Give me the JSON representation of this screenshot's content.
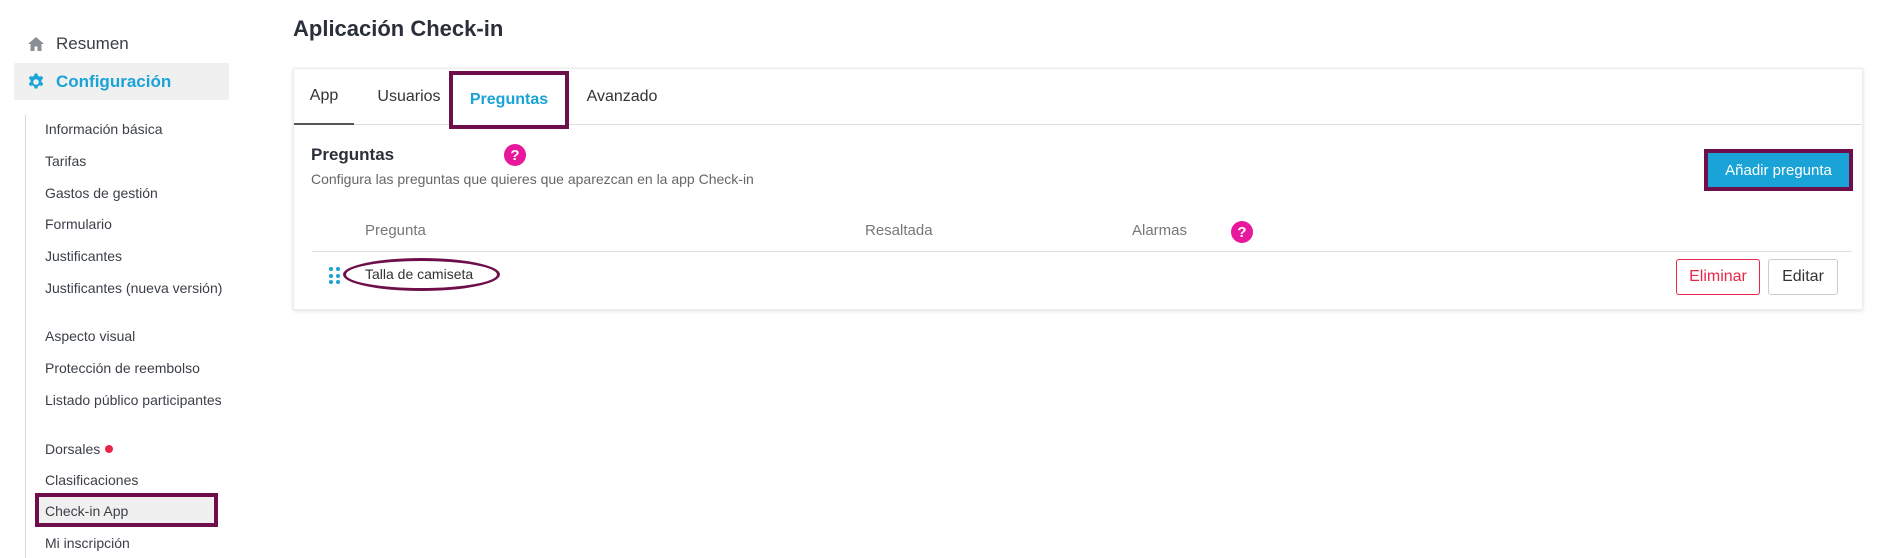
{
  "sidebar": {
    "resumen_label": "Resumen",
    "config_label": "Configuración",
    "items": [
      "Información básica",
      "Tarifas",
      "Gastos de gestión",
      "Formulario",
      "Justificantes",
      "Justificantes (nueva versión)",
      "Aspecto visual",
      "Protección de reembolso",
      "Listado público participantes",
      "Dorsales",
      "Clasificaciones",
      "Check-in App",
      "Mi inscripción"
    ],
    "active_item": "Check-in App"
  },
  "page": {
    "title": "Aplicación Check-in"
  },
  "tabs": {
    "app": "App",
    "usuarios": "Usuarios",
    "preguntas": "Preguntas",
    "avanzado": "Avanzado",
    "active": "Preguntas"
  },
  "section": {
    "title": "Preguntas",
    "subtitle": "Configura las preguntas que quieres que aparezcan en la app Check-in",
    "help": "?",
    "add_button": "Añadir pregunta"
  },
  "table": {
    "columns": [
      "Pregunta",
      "Resaltada",
      "Alarmas"
    ],
    "help": "?",
    "rows": [
      {
        "pregunta": "Talla de camiseta",
        "delete_label": "Eliminar",
        "edit_label": "Editar"
      }
    ]
  },
  "colors": {
    "accent": "#1aa3d6",
    "highlight": "#6e0f4b",
    "help": "#e7189b",
    "danger": "#e8264a"
  },
  "icons": {
    "resumen": "home-icon",
    "config": "gear-icon",
    "drag": "drag-handle-icon",
    "help": "question-icon"
  }
}
